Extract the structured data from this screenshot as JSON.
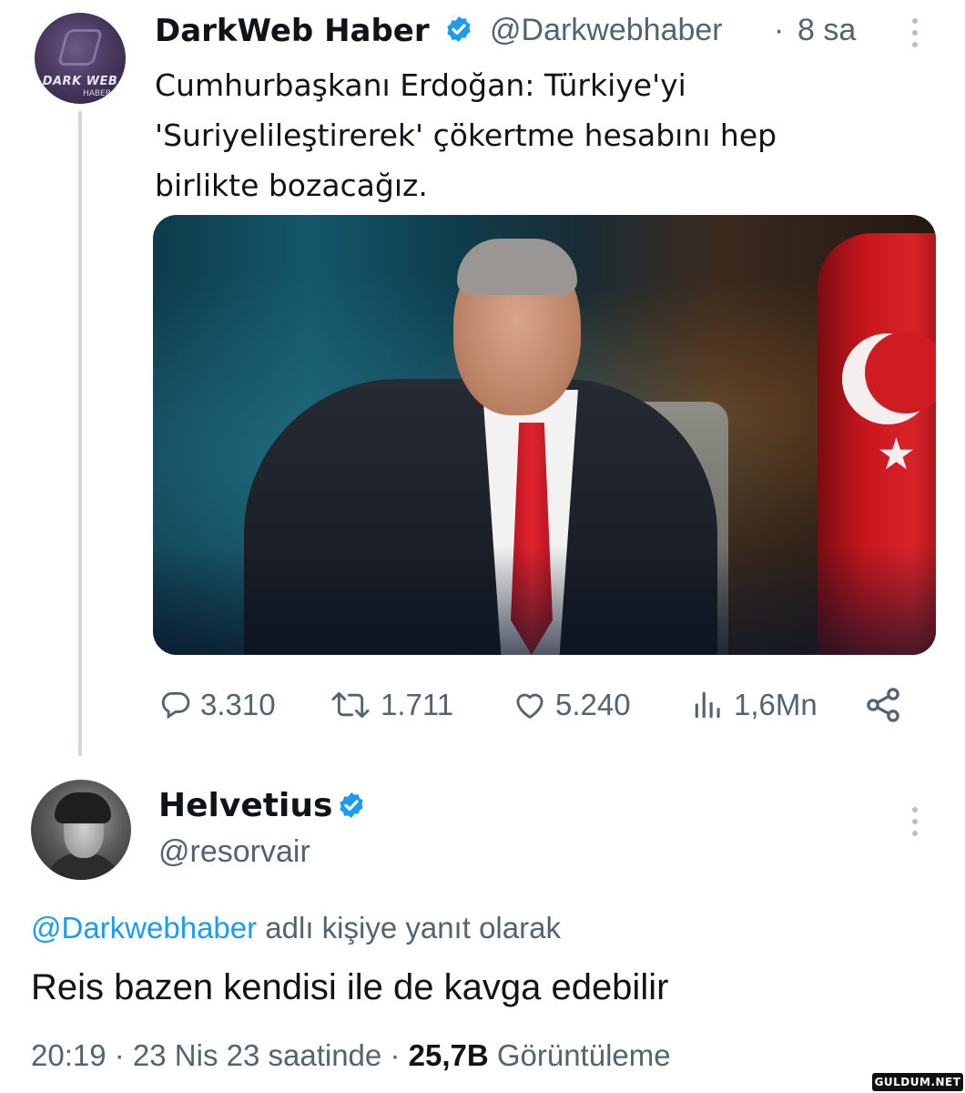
{
  "colors": {
    "text_primary": "#0f1419",
    "text_secondary": "#536471",
    "link_blue": "#1d9bf0",
    "verified_blue": "#1d9bf0",
    "thread_line": "#cfd9de"
  },
  "tweet": {
    "display_name": "DarkWeb Haber",
    "handle": "@Darkwebhaber",
    "separator": "·",
    "time_ago": "8 sa",
    "text_lines": [
      "Cumhurbaşkanı Erdoğan: Türkiye'yi",
      "'Suriyelileştirerek' çökertme hesabını hep",
      "birlikte bozacağız."
    ],
    "avatar_logo_text": "DARK WEB",
    "avatar_logo_sub": "HABER",
    "media_description_icon": "photo",
    "stats": {
      "replies": "3.310",
      "retweets": "1.711",
      "likes": "5.240",
      "views": "1,6Mn"
    }
  },
  "reply": {
    "display_name": "Helvetius",
    "handle": "@resorvair",
    "replying_to_mention": "@Darkwebhaber",
    "replying_to_suffix": " adlı kişiye yanıt olarak",
    "text": "Reis bazen kendisi ile de kavga edebilir",
    "meta": {
      "time": "20:19",
      "sep1": " · ",
      "date": "23 Nis 23 saatinde",
      "sep2": " · ",
      "views_count": "25,7B",
      "views_label": " Görüntüleme"
    }
  },
  "watermark": "GULDUM.NET"
}
